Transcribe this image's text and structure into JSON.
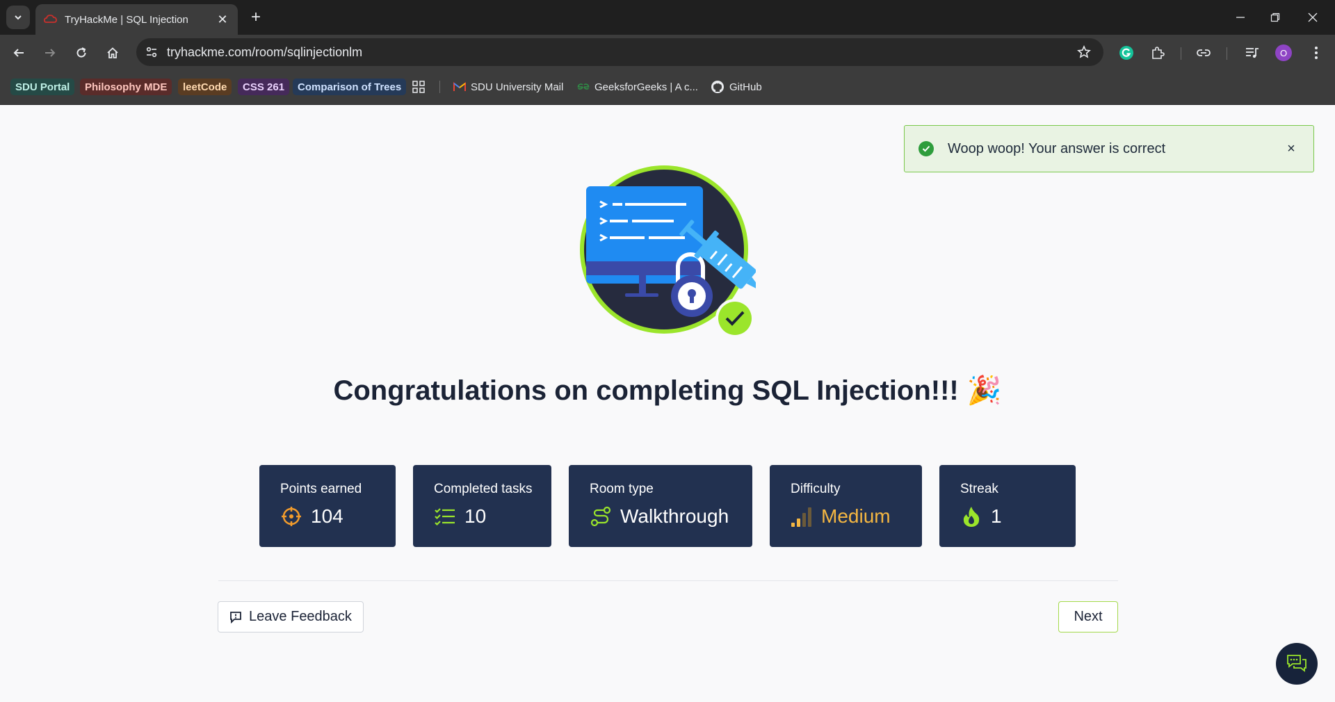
{
  "browser": {
    "tab_title": "TryHackMe | SQL Injection",
    "url": "tryhackme.com/room/sqlinjectionlm",
    "profile_initial": "O",
    "bookmarks": [
      {
        "label": "SDU Portal",
        "bg": "#254a46",
        "fg": "#bff0e6"
      },
      {
        "label": "Philosophy MDE",
        "bg": "#5a2c2a",
        "fg": "#ffc7bf"
      },
      {
        "label": "leetCode",
        "bg": "#5a3c22",
        "fg": "#ffd9b0"
      },
      {
        "label": "CSS 261",
        "bg": "#452a5a",
        "fg": "#ecd4ff"
      },
      {
        "label": "Comparison of Trees",
        "bg": "#253a58",
        "fg": "#cfe2ff"
      }
    ],
    "bookmark_links": [
      "SDU University Mail",
      "GeeksforGeeks | A c...",
      "GitHub"
    ]
  },
  "toast": {
    "message": "Woop woop! Your answer is correct",
    "close": "×"
  },
  "page": {
    "congrats_title": "Congratulations on completing SQL Injection!!!",
    "congrats_emoji": "🎉",
    "stats": [
      {
        "label": "Points earned",
        "value": "104",
        "icon": "crosshair-icon"
      },
      {
        "label": "Completed tasks",
        "value": "10",
        "icon": "checklist-icon"
      },
      {
        "label": "Room type",
        "value": "Walkthrough",
        "icon": "route-icon"
      },
      {
        "label": "Difficulty",
        "value": "Medium",
        "icon": "signal-bars-icon"
      },
      {
        "label": "Streak",
        "value": "1",
        "icon": "flame-icon"
      }
    ],
    "feedback_label": "Leave Feedback",
    "next_label": "Next"
  },
  "colors": {
    "card_bg": "#223150",
    "accent_green": "#a3d94a",
    "difficulty_medium": "#f5b742",
    "toast_border": "#79c84a"
  }
}
